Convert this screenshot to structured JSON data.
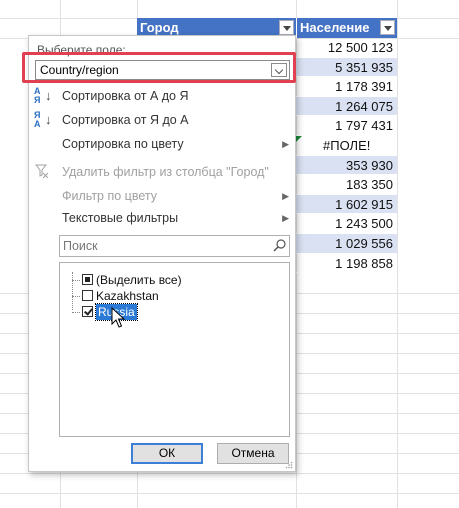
{
  "sheet": {
    "headers": {
      "city": "Город",
      "population": "Население"
    },
    "population_values": [
      "12 500 123",
      "5 351 935",
      "1 178 391",
      "1 264 075",
      "1 797 431",
      "#ПОЛЕ!",
      "353 930",
      "183 350",
      "1 602 915",
      "1 243 500",
      "1 029 556",
      "1 198 858"
    ],
    "colors": {
      "header": "#4472c4",
      "band": "#d9e1f2",
      "error_marker": "#1b8a3a"
    }
  },
  "filter_popup": {
    "field_label": "Выберите поле:",
    "field_value": "Country/region",
    "highlight_color": "#e04050",
    "menu": [
      {
        "label": "Сортировка от А до Я",
        "icon": "sort-az-icon",
        "enabled": true,
        "submenu": false
      },
      {
        "label": "Сортировка от Я до А",
        "icon": "sort-za-icon",
        "enabled": true,
        "submenu": false
      },
      {
        "label": "Сортировка по цвету",
        "icon": "",
        "enabled": true,
        "submenu": true
      },
      {
        "label": "Удалить фильтр из столбца \"Город\"",
        "icon": "clear-filter-icon",
        "enabled": false,
        "submenu": false
      },
      {
        "label": "Фильтр по цвету",
        "icon": "",
        "enabled": false,
        "submenu": true
      },
      {
        "label": "Текстовые фильтры",
        "icon": "",
        "enabled": true,
        "submenu": true
      }
    ],
    "search_placeholder": "Поиск",
    "items": [
      {
        "label": "(Выделить все)",
        "state": "indeterminate"
      },
      {
        "label": "Kazakhstan",
        "state": "unchecked"
      },
      {
        "label": "Russia",
        "state": "checked",
        "selected": true
      }
    ],
    "ok_label": "ОК",
    "cancel_label": "Отмена"
  }
}
